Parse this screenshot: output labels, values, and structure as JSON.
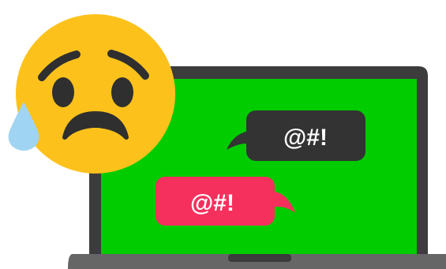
{
  "illustration": {
    "dark_bubble_text": "@#!",
    "pink_bubble_text": "@#!",
    "icons": {
      "emoji": "sad-face-with-sweat-icon",
      "laptop": "laptop-icon"
    },
    "colors": {
      "screen_green": "#00cc00",
      "laptop_frame": "#3c3c3c",
      "laptop_base": "#666666",
      "dark_bubble": "#333333",
      "pink_bubble": "#f5305d",
      "emoji_yellow": "#fcc21b",
      "emoji_features": "#2f2f2f",
      "sweat_drop": "#9fd4f2"
    }
  }
}
